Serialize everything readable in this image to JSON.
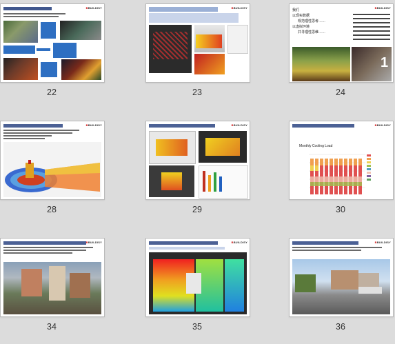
{
  "slides": [
    {
      "number": "22"
    },
    {
      "number": "23"
    },
    {
      "number": "24",
      "lines": [
        "我们",
        "以现实数据",
        "规范理性思考……",
        "以虚拟环境",
        "并寻理性思维……"
      ]
    },
    {
      "number": "28"
    },
    {
      "number": "29"
    },
    {
      "number": "30",
      "chart_title": "Monthly Cooling Load"
    },
    {
      "number": "34"
    },
    {
      "number": "35"
    },
    {
      "number": "36"
    }
  ],
  "colors": {
    "background": "#dcdcdc",
    "slide_bg": "#ffffff",
    "title_blue": "#1f3a7a",
    "arrow_blue": "#2e6fc2",
    "accent_red": "#c00000"
  },
  "logo_text": "BUILDISY"
}
